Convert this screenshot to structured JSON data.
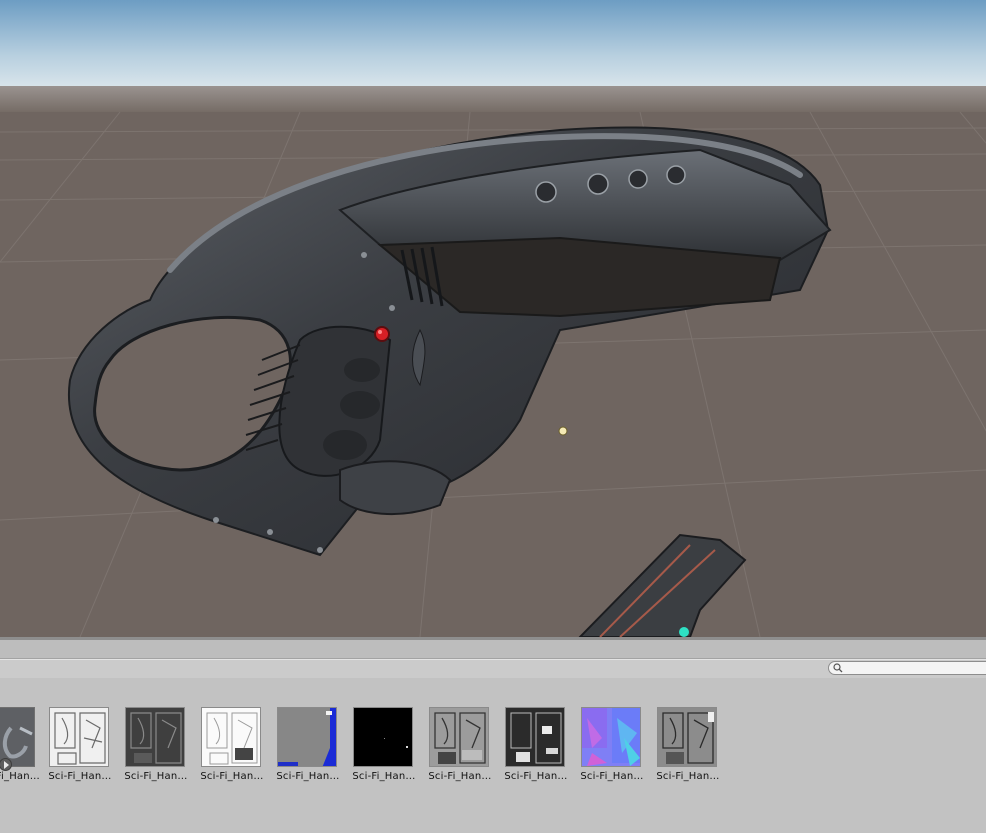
{
  "scene": {
    "sky_color_top": "#6e9ec4",
    "sky_color_horizon": "#e3ebef",
    "ground_color": "#6f6560"
  },
  "search": {
    "placeholder": ""
  },
  "assets": [
    {
      "label": "Sci-Fi_Han…",
      "icon": "model-prefab-icon",
      "truncated_left": true
    },
    {
      "label": "Sci-Fi_Han…",
      "icon": "white-texture-thumbnail"
    },
    {
      "label": "Sci-Fi_Han…",
      "icon": "dark-texture-thumbnail"
    },
    {
      "label": "Sci-Fi_Han…",
      "icon": "light-texture-thumbnail"
    },
    {
      "label": "Sci-Fi_Han…",
      "icon": "gray-texture-thumbnail"
    },
    {
      "label": "Sci-Fi_Han…",
      "icon": "black-texture-thumbnail"
    },
    {
      "label": "Sci-Fi_Han…",
      "icon": "gray-detail-texture-thumbnail"
    },
    {
      "label": "Sci-Fi_Han…",
      "icon": "dark-detail-texture-thumbnail"
    },
    {
      "label": "Sci-Fi_Han…",
      "icon": "normal-map-thumbnail"
    },
    {
      "label": "Sci-Fi_Han…",
      "icon": "grayscale-texture-thumbnail"
    }
  ]
}
